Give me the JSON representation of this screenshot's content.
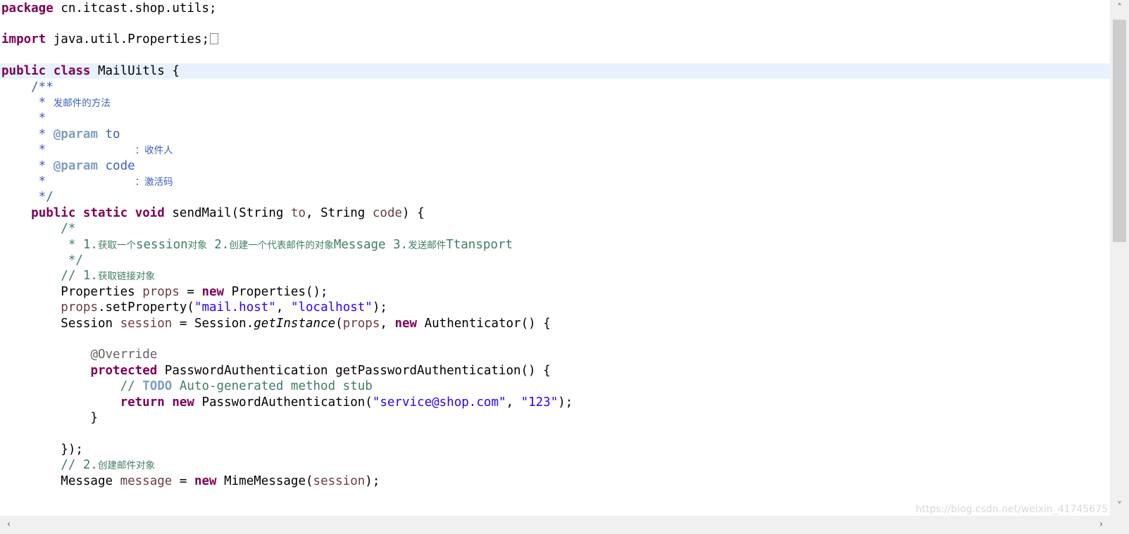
{
  "editor": {
    "lines": [
      [
        {
          "t": "package",
          "c": "kw"
        },
        {
          "t": " cn.itcast.shop.utils;"
        }
      ],
      [],
      [
        {
          "t": "import",
          "c": "kw"
        },
        {
          "t": " java.util.Properties;"
        },
        {
          "t": "",
          "c": "fold"
        }
      ],
      [],
      [
        {
          "t": "public",
          "c": "kw"
        },
        {
          "t": " "
        },
        {
          "t": "class",
          "c": "kw"
        },
        {
          "t": " MailUitls {"
        }
      ],
      [
        {
          "t": "    /**",
          "c": "jdoc"
        }
      ],
      [
        {
          "t": "     * ",
          "c": "jdoc"
        },
        {
          "t": "发邮件的方法",
          "c": "jdoc cjk"
        }
      ],
      [
        {
          "t": "     *",
          "c": "jdoc"
        }
      ],
      [
        {
          "t": "     * ",
          "c": "jdoc"
        },
        {
          "t": "@param",
          "c": "jtag"
        },
        {
          "t": " to",
          "c": "jdoc"
        }
      ],
      [
        {
          "t": "     *            ",
          "c": "jdoc"
        },
        {
          "t": "：收件人",
          "c": "jdoc cjk"
        }
      ],
      [
        {
          "t": "     * ",
          "c": "jdoc"
        },
        {
          "t": "@param",
          "c": "jtag"
        },
        {
          "t": " code",
          "c": "jdoc"
        }
      ],
      [
        {
          "t": "     *            ",
          "c": "jdoc"
        },
        {
          "t": "：激活码",
          "c": "jdoc cjk"
        }
      ],
      [
        {
          "t": "     */",
          "c": "jdoc"
        }
      ],
      [
        {
          "t": "    "
        },
        {
          "t": "public",
          "c": "kw"
        },
        {
          "t": " "
        },
        {
          "t": "static",
          "c": "kw"
        },
        {
          "t": " "
        },
        {
          "t": "void",
          "c": "kw"
        },
        {
          "t": " sendMail(String "
        },
        {
          "t": "to",
          "c": "var"
        },
        {
          "t": ", String "
        },
        {
          "t": "code",
          "c": "var"
        },
        {
          "t": ") {"
        }
      ],
      [
        {
          "t": "        /*",
          "c": "cmt"
        }
      ],
      [
        {
          "t": "         * 1.",
          "c": "cmt"
        },
        {
          "t": "获取一个",
          "c": "cmt cjk"
        },
        {
          "t": "session",
          "c": "cmt"
        },
        {
          "t": "对象",
          "c": "cmt cjk"
        },
        {
          "t": " 2.",
          "c": "cmt"
        },
        {
          "t": "创建一个代表邮件的对象",
          "c": "cmt cjk"
        },
        {
          "t": "Message 3.",
          "c": "cmt"
        },
        {
          "t": "发送邮件",
          "c": "cmt cjk"
        },
        {
          "t": "Ttansport",
          "c": "cmt"
        }
      ],
      [
        {
          "t": "         */",
          "c": "cmt"
        }
      ],
      [
        {
          "t": "        // 1.",
          "c": "cmt"
        },
        {
          "t": "获取链接对象",
          "c": "cmt cjk"
        }
      ],
      [
        {
          "t": "        Properties "
        },
        {
          "t": "props",
          "c": "var"
        },
        {
          "t": " = "
        },
        {
          "t": "new",
          "c": "kw"
        },
        {
          "t": " Properties();"
        }
      ],
      [
        {
          "t": "        "
        },
        {
          "t": "props",
          "c": "var"
        },
        {
          "t": ".setProperty("
        },
        {
          "t": "\"mail.host\"",
          "c": "str"
        },
        {
          "t": ", "
        },
        {
          "t": "\"localhost\"",
          "c": "str"
        },
        {
          "t": ");"
        }
      ],
      [
        {
          "t": "        Session "
        },
        {
          "t": "session",
          "c": "var"
        },
        {
          "t": " = Session."
        },
        {
          "t": "getInstance",
          "c": "static-call"
        },
        {
          "t": "("
        },
        {
          "t": "props",
          "c": "var"
        },
        {
          "t": ", "
        },
        {
          "t": "new",
          "c": "kw"
        },
        {
          "t": " Authenticator() {"
        }
      ],
      [],
      [
        {
          "t": "            "
        },
        {
          "t": "@Override",
          "c": "ann"
        }
      ],
      [
        {
          "t": "            "
        },
        {
          "t": "protected",
          "c": "kw"
        },
        {
          "t": " PasswordAuthentication getPasswordAuthentication() {"
        }
      ],
      [
        {
          "t": "                // ",
          "c": "cmt"
        },
        {
          "t": "TODO",
          "c": "todo"
        },
        {
          "t": " Auto-generated method stub",
          "c": "cmt"
        }
      ],
      [
        {
          "t": "                "
        },
        {
          "t": "return",
          "c": "kw"
        },
        {
          "t": " "
        },
        {
          "t": "new",
          "c": "kw"
        },
        {
          "t": " PasswordAuthentication("
        },
        {
          "t": "\"service@shop.com\"",
          "c": "str"
        },
        {
          "t": ", "
        },
        {
          "t": "\"123\"",
          "c": "str"
        },
        {
          "t": ");"
        }
      ],
      [
        {
          "t": "            }"
        }
      ],
      [],
      [
        {
          "t": "        });"
        }
      ],
      [
        {
          "t": "        // 2.",
          "c": "cmt"
        },
        {
          "t": "创建邮件对象",
          "c": "cmt cjk"
        }
      ],
      [
        {
          "t": "        Message "
        },
        {
          "t": "message",
          "c": "var"
        },
        {
          "t": " = "
        },
        {
          "t": "new",
          "c": "kw"
        },
        {
          "t": " MimeMessage("
        },
        {
          "t": "session",
          "c": "var"
        },
        {
          "t": ");"
        }
      ]
    ],
    "current_line_index": 4
  },
  "scrollbar": {
    "up_icon": "˄",
    "down_icon": "˅",
    "left_icon": "‹",
    "right_icon": "›"
  },
  "watermark": "https://blog.csdn.net/weixin_41745675"
}
